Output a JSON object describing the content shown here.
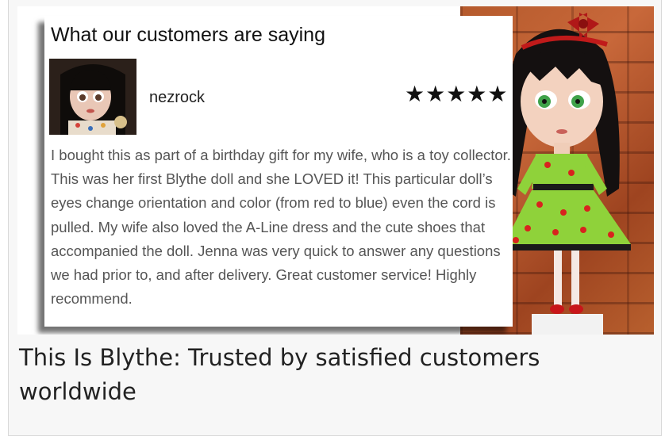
{
  "testimonial": {
    "heading": "What our customers are saying",
    "reviewer": "nezrock",
    "rating_text": "★★★★★",
    "rating": 5,
    "review": "I bought this as part of a birthday gift for my wife, who is a toy collector. This was her first Blythe doll and she LOVED it! This particular doll’s eyes change orientation and color (from red to blue) even the cord is pulled. My wife also loved the A-Line dress and the cute shoes that accompanied the doll. Jenna was very quick to answer any questions we had prior to, and after delivery. Great customer service! Highly recommend."
  },
  "caption": "This Is Blythe: Trusted by satisfied customers worldwide",
  "colors": {
    "brick": "#b55a2c",
    "dress_green": "#8fd23a",
    "ladybug_red": "#d8231e"
  }
}
